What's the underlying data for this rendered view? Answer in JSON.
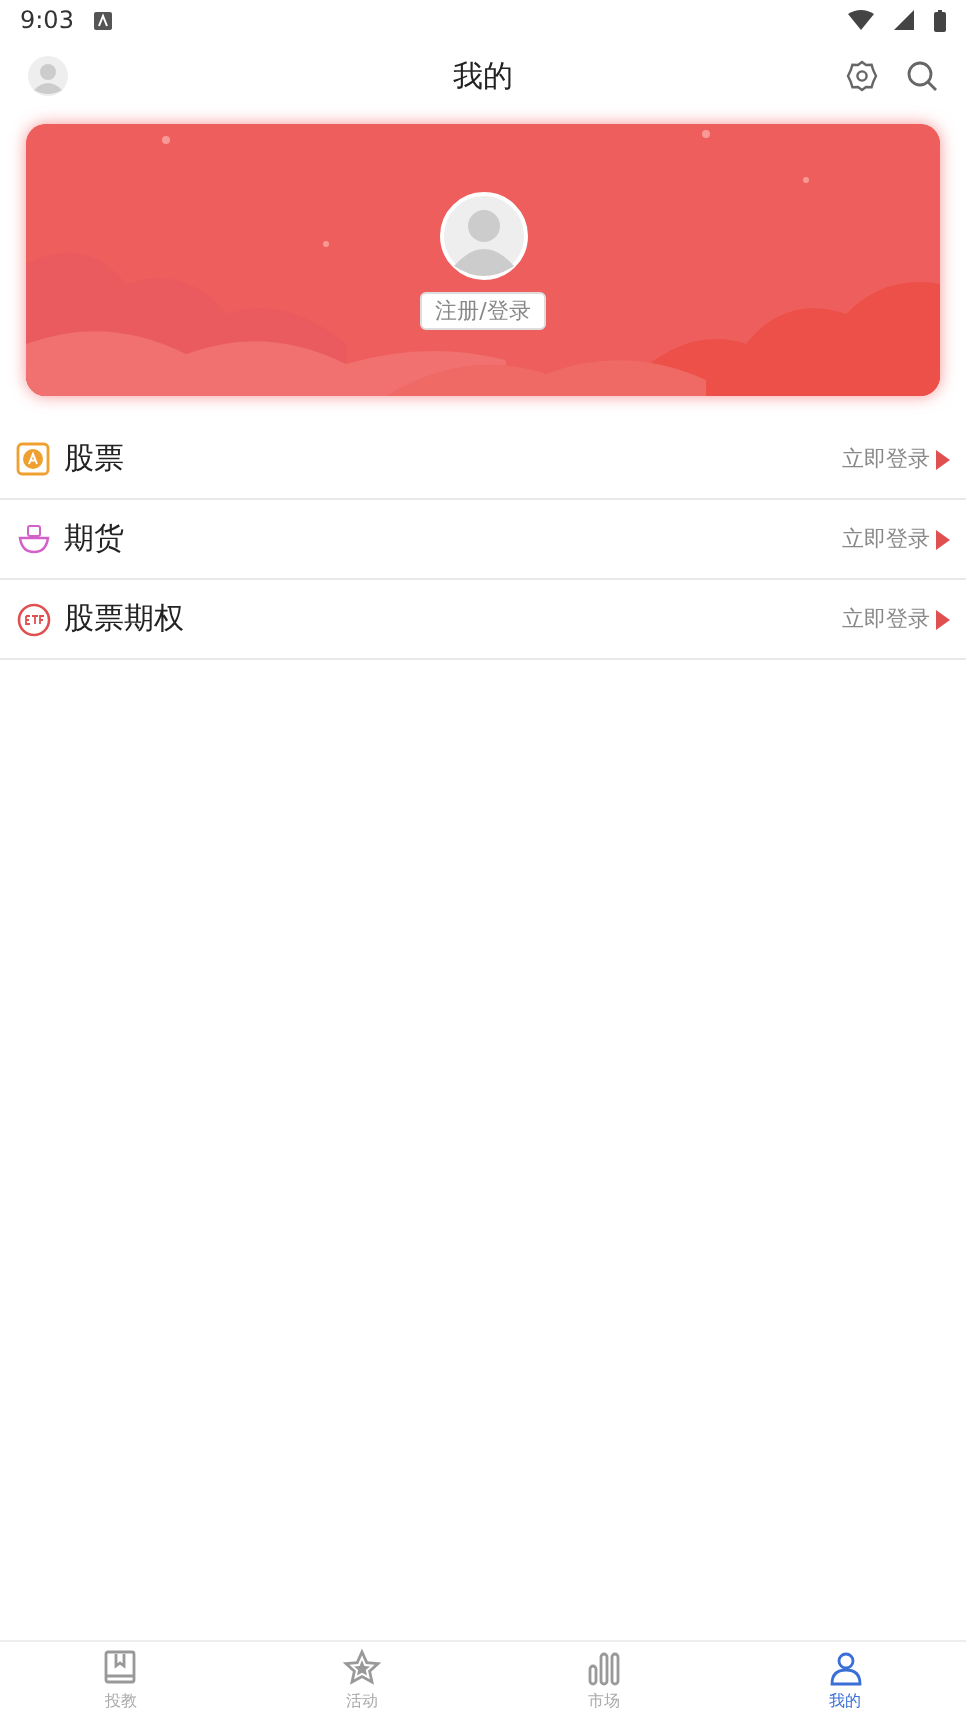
{
  "status_bar": {
    "time": "9:03"
  },
  "header": {
    "title": "我的"
  },
  "profile": {
    "login_button": "注册/登录"
  },
  "menu": [
    {
      "kind": "stock",
      "label": "股票",
      "action": "立即登录"
    },
    {
      "kind": "futures",
      "label": "期货",
      "action": "立即登录"
    },
    {
      "kind": "option",
      "label": "股票期权",
      "action": "立即登录"
    }
  ],
  "tabs": [
    {
      "kind": "book",
      "label": "投教",
      "selected": false
    },
    {
      "kind": "star",
      "label": "活动",
      "selected": false
    },
    {
      "kind": "bars",
      "label": "市场",
      "selected": false
    },
    {
      "kind": "person",
      "label": "我的",
      "selected": true
    }
  ]
}
